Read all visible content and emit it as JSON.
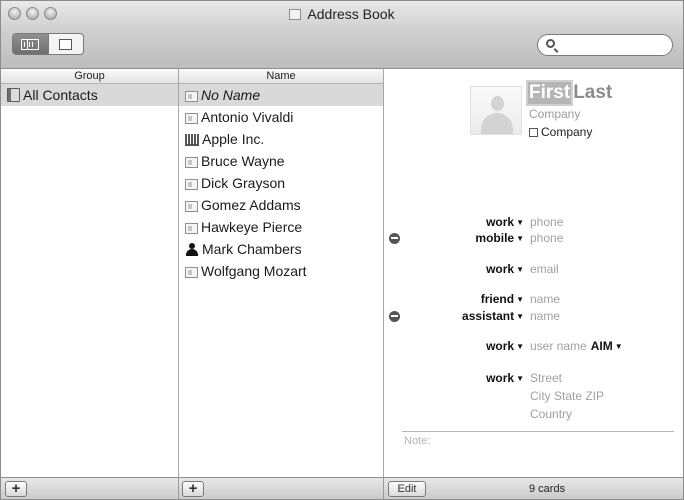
{
  "window": {
    "title": "Address Book"
  },
  "toolbar": {
    "view_buttons": [
      "list-and-card-view",
      "card-only-view"
    ],
    "search": {
      "placeholder": "",
      "value": ""
    }
  },
  "group_column": {
    "header": "Group",
    "items": [
      {
        "label": "All Contacts",
        "selected": true
      }
    ]
  },
  "name_column": {
    "header": "Name",
    "items": [
      {
        "label": "No Name",
        "icon": "card-icon",
        "selected": true,
        "italic": true
      },
      {
        "label": "Antonio Vivaldi",
        "icon": "card-icon"
      },
      {
        "label": "Apple Inc.",
        "icon": "company-icon"
      },
      {
        "label": "Bruce Wayne",
        "icon": "card-icon"
      },
      {
        "label": "Dick Grayson",
        "icon": "card-icon"
      },
      {
        "label": "Gomez Addams",
        "icon": "card-icon"
      },
      {
        "label": "Hawkeye Pierce",
        "icon": "card-icon"
      },
      {
        "label": "Mark Chambers",
        "icon": "me-icon"
      },
      {
        "label": "Wolfgang Mozart",
        "icon": "card-icon"
      }
    ]
  },
  "card": {
    "first": "First",
    "last": "Last",
    "company_placeholder": "Company",
    "company_checkbox_label": "Company",
    "phones": [
      {
        "label": "work",
        "value": "phone"
      },
      {
        "label": "mobile",
        "value": "phone"
      }
    ],
    "email": {
      "label": "work",
      "value": "email"
    },
    "related": [
      {
        "label": "friend",
        "value": "name"
      },
      {
        "label": "assistant",
        "value": "name"
      }
    ],
    "im": {
      "label": "work",
      "value": "user name",
      "service": "AIM"
    },
    "address": {
      "label": "work",
      "street": "Street",
      "city_line": "City  State  ZIP",
      "country": "Country"
    },
    "note_label": "Note:"
  },
  "bottombar": {
    "add_group_label": "+",
    "add_person_label": "+",
    "edit_label": "Edit",
    "count": "9 cards"
  }
}
